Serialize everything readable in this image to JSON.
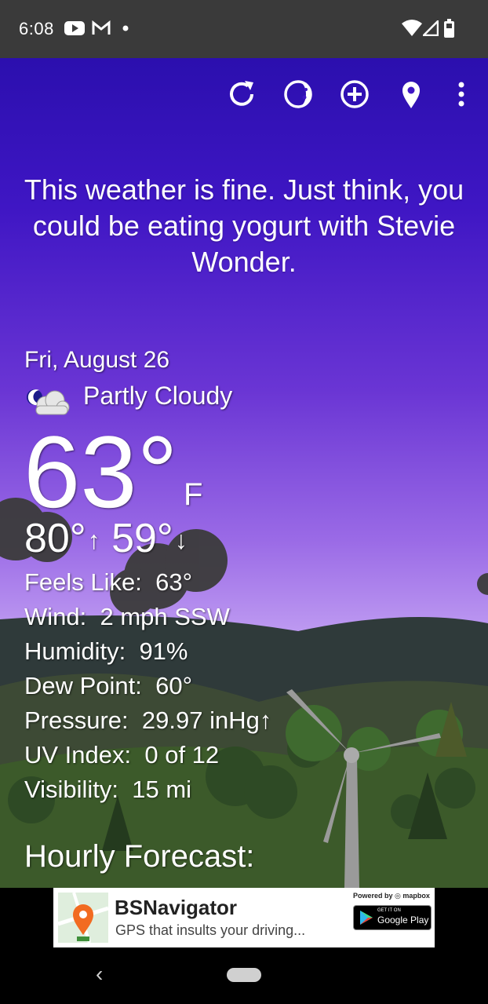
{
  "status": {
    "time": "6:08",
    "left_icons": [
      "youtube-icon",
      "gmail-icon",
      "dot-icon"
    ],
    "right_icons": [
      "wifi-icon",
      "signal-icon",
      "battery-icon"
    ]
  },
  "toolbar": {
    "icons": [
      "refresh-icon",
      "moon-phase-icon",
      "add-location-icon",
      "location-pin-icon",
      "more-vert-icon"
    ]
  },
  "quote": "This weather is fine. Just think, you could be eating yogurt with Stevie Wonder.",
  "weather": {
    "date": "Fri, August 26",
    "condition": "Partly Cloudy",
    "condition_icon": "partly-cloudy-night-icon",
    "temperature": "63°",
    "unit": "F",
    "high": "80°",
    "high_arrow": "↑",
    "low": "59°",
    "low_arrow": "↓",
    "details": [
      {
        "label": "Feels Like:",
        "value": "63°"
      },
      {
        "label": "Wind:",
        "value": "2 mph SSW"
      },
      {
        "label": "Humidity:",
        "value": "91%"
      },
      {
        "label": "Dew Point:",
        "value": "60°"
      },
      {
        "label": "Pressure:",
        "value": "29.97 inHg↑"
      },
      {
        "label": "UV Index:",
        "value": "0 of 12"
      },
      {
        "label": "Visibility:",
        "value": "15 mi"
      }
    ],
    "hourly_heading": "Hourly Forecast:"
  },
  "ad": {
    "title": "BSNavigator",
    "subtitle": "GPS that insults your driving...",
    "powered_by": "Powered by ◎ mapbox",
    "store_small": "GET IT ON",
    "store_big": "Google Play"
  },
  "colors": {
    "sky_top": "#2b0fae",
    "sky_bottom": "#d8c4f5",
    "status_bar": "#3a3a3a"
  }
}
